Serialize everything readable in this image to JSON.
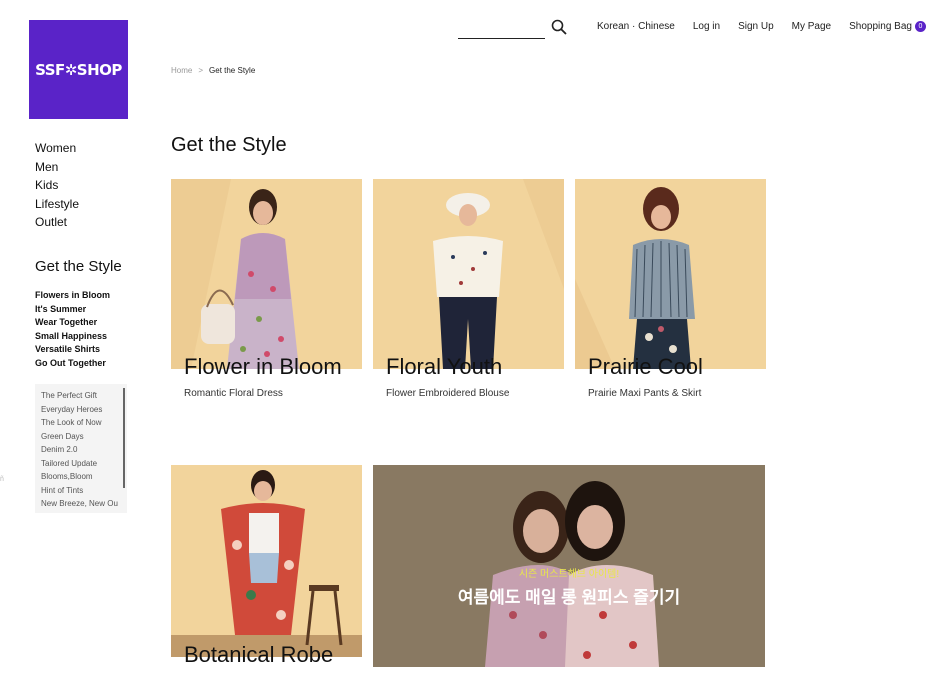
{
  "logo": {
    "text": "SSF✲SHOP",
    "color": "#5a23c8"
  },
  "search": {
    "placeholder": ""
  },
  "top_nav": {
    "language": "Korean · Chinese",
    "login": "Log in",
    "signup": "Sign Up",
    "mypage": "My Page",
    "bag": "Shopping Bag",
    "bag_count": "0"
  },
  "breadcrumb": {
    "home": "Home",
    "separator": ">",
    "current": "Get the Style"
  },
  "sidebar": {
    "categories": [
      "Women",
      "Men",
      "Kids",
      "Lifestyle",
      "Outlet"
    ],
    "heading": "Get the Style",
    "styles": [
      "Flowers in Bloom",
      "It's Summer",
      "Wear Together",
      "Small Happiness",
      "Versatile Shirts",
      "Go Out Together"
    ],
    "more_styles": [
      "The Perfect Gift",
      "Everyday Heroes",
      "The Look of Now",
      "Green Days",
      "Denim 2.0",
      "Tailored Update",
      "Blooms,Bloom",
      "Hint of Tints",
      "New Breeze, New Ou"
    ]
  },
  "page_title": "Get the Style",
  "cards": [
    {
      "title": "Flower in Bloom",
      "subtitle": "Romantic Floral Dress"
    },
    {
      "title": "Floral Youth",
      "subtitle": "Flower Embroidered Blouse"
    },
    {
      "title": "Prairie Cool",
      "subtitle": "Prairie Maxi Pants & Skirt"
    },
    {
      "title": "Botanical Robe",
      "subtitle": ""
    }
  ],
  "banner": {
    "subtitle": "시즌 머스트해브 아이템!",
    "title": "여름에도 매일 롱 원피스 즐기기"
  },
  "edge_mark": "ñ",
  "colors": {
    "accent": "#5a23c8",
    "card_bg": "#f2d49c",
    "banner_bg": "#9a8a70",
    "banner_sub": "#e8e64a"
  }
}
